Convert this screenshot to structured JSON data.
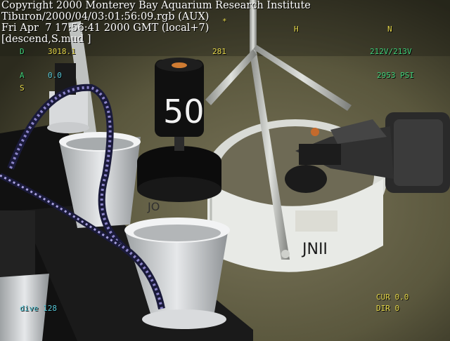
{
  "overlay": {
    "header_lines": [
      "Copyright 2000 Monterey Bay Aquarium Research Institute",
      "Tiburon/2000/04/03:01:56:09.rgb (AUX)",
      "Fri Apr  7 17:56:41 2000 GMT (local+7)",
      "[descend,S.mud ]"
    ],
    "heading_marks": [
      "*",
      "H",
      "N"
    ],
    "hud": {
      "d_label": "D",
      "depth": "3018.1",
      "heading": "281",
      "voltage": "212V/213V",
      "a_label": "A",
      "altitude": "0.0",
      "s_label": "S",
      "pressure": "2953 PSI",
      "dive": "dive 128",
      "cur": "CUR 0.0",
      "dir": "DIR 0"
    }
  },
  "scene": {
    "sample_label": "50",
    "drum_marks": "JNII",
    "cup_marks": "JO"
  }
}
